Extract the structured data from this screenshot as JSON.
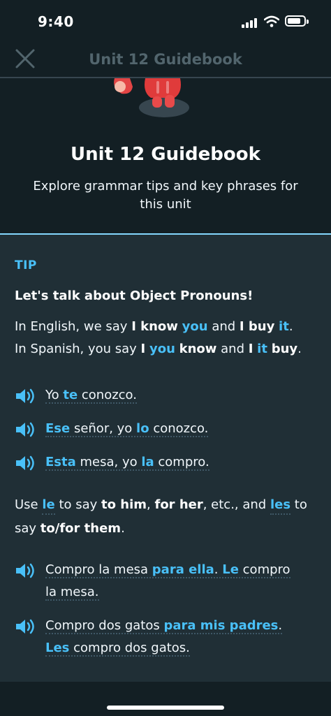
{
  "status": {
    "time": "9:40"
  },
  "nav": {
    "title": "Unit 12 Guidebook"
  },
  "hero": {
    "title": "Unit 12 Guidebook",
    "subtitle": "Explore grammar tips and key phrases for this unit"
  },
  "tip": {
    "label": "TIP",
    "heading": "Let's talk about Object Pronouns!",
    "intro": {
      "line1": [
        "In English, we say ",
        "I know",
        " ",
        "you",
        " and ",
        "I buy",
        " ",
        "it",
        "."
      ],
      "line2": [
        "In Spanish, you say ",
        "I",
        " ",
        "you",
        " ",
        "know",
        " and ",
        "I",
        " ",
        "it",
        " ",
        "buy",
        "."
      ]
    },
    "examples1": [
      {
        "parts": [
          "Yo ",
          "te",
          " conozco."
        ]
      },
      {
        "parts": [
          "Ese",
          " señor, yo ",
          "lo",
          " conozco."
        ]
      },
      {
        "parts": [
          "Esta",
          " mesa, yo ",
          "la",
          " compro."
        ]
      }
    ],
    "usage": {
      "parts": [
        "Use ",
        "le",
        " to say ",
        "to him",
        ", ",
        "for her",
        ", etc., and ",
        "les",
        " to say ",
        "to/for them",
        "."
      ]
    },
    "examples2": [
      {
        "line1": [
          "Compro la mesa ",
          "para ella",
          ". ",
          "Le",
          " compro"
        ],
        "line2": [
          "la mesa."
        ]
      },
      {
        "line1": [
          "Compro dos gatos ",
          "para mis padres",
          "."
        ],
        "line2": [
          "Les",
          " compro dos gatos."
        ]
      }
    ]
  },
  "colors": {
    "background": "#131f24",
    "card": "#202f36",
    "accent": "#49c0f8",
    "divider": "#84d8ff"
  },
  "icons": {
    "close": "close-icon",
    "speaker": "speaker-icon",
    "wifi": "wifi-icon",
    "battery": "battery-icon",
    "signal": "signal-icon"
  }
}
